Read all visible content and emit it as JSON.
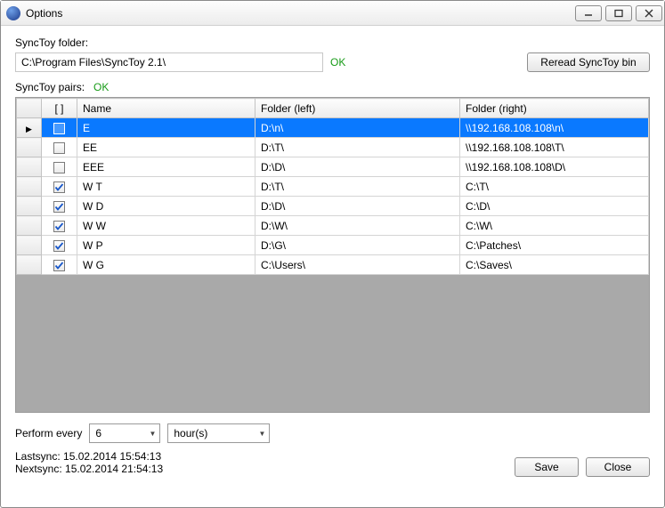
{
  "window": {
    "title": "Options"
  },
  "labels": {
    "synctoy_folder": "SyncToy folder:",
    "synctoy_pairs": "SyncToy pairs:",
    "perform_every": "Perform every",
    "lastsync_prefix": "Lastsync:",
    "nextsync_prefix": "Nextsync:"
  },
  "folder": {
    "value": "C:\\Program Files\\SyncToy 2.1\\",
    "status": "OK"
  },
  "pairs_status": "OK",
  "buttons": {
    "reread": "Reread SyncToy bin",
    "save": "Save",
    "close": "Close"
  },
  "interval": {
    "value": "6",
    "unit": "hour(s)"
  },
  "lastsync": "15.02.2014 15:54:13",
  "nextsync": "15.02.2014 21:54:13",
  "columns": {
    "chk": "[ ]",
    "name": "Name",
    "left": "Folder (left)",
    "right": "Folder (right)"
  },
  "rows": [
    {
      "checked": false,
      "name": "E",
      "left": "D:\\n\\",
      "right": "\\\\192.168.108.108\\n\\",
      "selected": true
    },
    {
      "checked": false,
      "name": "EE",
      "left": "D:\\T\\",
      "right": "\\\\192.168.108.108\\T\\"
    },
    {
      "checked": false,
      "name": "EEE",
      "left": "D:\\D\\",
      "right": "\\\\192.168.108.108\\D\\"
    },
    {
      "checked": true,
      "name": "W T",
      "left": "D:\\T\\",
      "right": "C:\\T\\"
    },
    {
      "checked": true,
      "name": "W D",
      "left": "D:\\D\\",
      "right": "C:\\D\\"
    },
    {
      "checked": true,
      "name": "W W",
      "left": "D:\\W\\",
      "right": "C:\\W\\"
    },
    {
      "checked": true,
      "name": "W P",
      "left": "D:\\G\\",
      "right": "C:\\Patches\\"
    },
    {
      "checked": true,
      "name": "W G",
      "left": "C:\\Users\\",
      "right": "C:\\Saves\\"
    }
  ]
}
